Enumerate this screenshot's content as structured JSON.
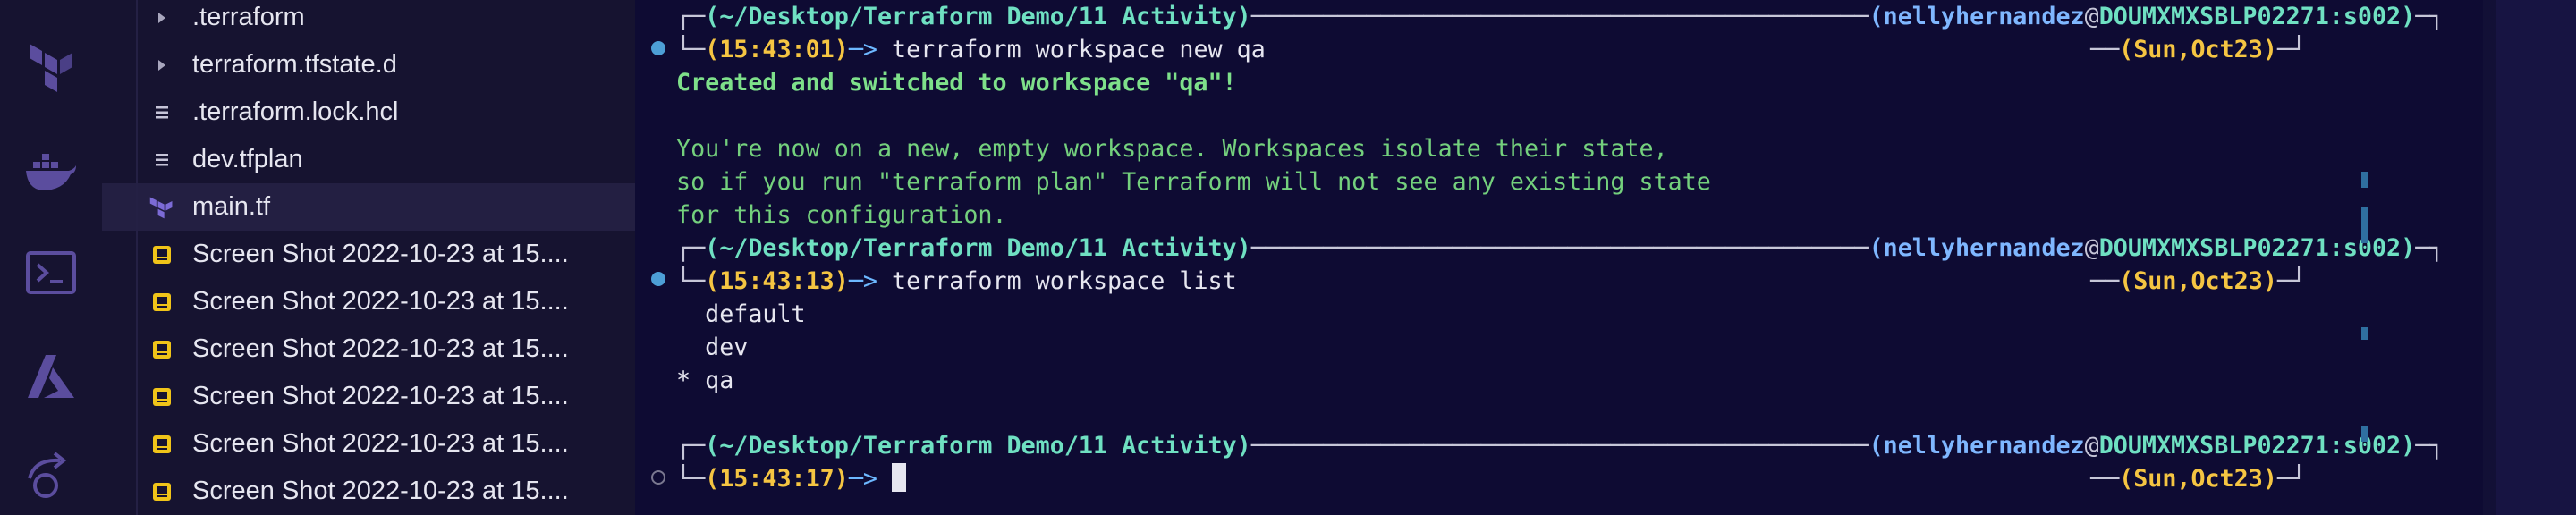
{
  "activity_bar": {
    "icons": [
      "terraform-icon",
      "docker-icon",
      "terminal-icon",
      "azure-icon",
      "remote-explorer-icon"
    ]
  },
  "explorer": {
    "items": [
      {
        "label": ".terraform",
        "icon": "chevron-right-icon"
      },
      {
        "label": "terraform.tfstate.d",
        "icon": "chevron-right-icon"
      },
      {
        "label": ".terraform.lock.hcl",
        "icon": "lines-file-icon"
      },
      {
        "label": "dev.tfplan",
        "icon": "lines-file-icon"
      },
      {
        "label": "main.tf",
        "icon": "terraform-file-icon"
      },
      {
        "label": "Screen Shot 2022-10-23 at 15....",
        "icon": "image-file-icon"
      },
      {
        "label": "Screen Shot 2022-10-23 at 15....",
        "icon": "image-file-icon"
      },
      {
        "label": "Screen Shot 2022-10-23 at 15....",
        "icon": "image-file-icon"
      },
      {
        "label": "Screen Shot 2022-10-23 at 15....",
        "icon": "image-file-icon"
      },
      {
        "label": "Screen Shot 2022-10-23 at 15....",
        "icon": "image-file-icon"
      },
      {
        "label": "Screen Shot 2022-10-23 at 15....",
        "icon": "image-file-icon"
      }
    ]
  },
  "terminal": {
    "prompt": {
      "path": "(~/Desktop/Terraform Demo/11 Activity)",
      "user": "(nellyhernandez",
      "at": "@",
      "host": "DOUMXMXSBLP02271:s002)",
      "date": "(Sun,Oct23)",
      "arrow": "─> "
    },
    "blocks": [
      {
        "time": "(15:43:01)",
        "command": "terraform workspace new qa"
      },
      {
        "time": "(15:43:13)",
        "command": "terraform workspace list"
      },
      {
        "time": "(15:43:17)",
        "command": ""
      }
    ],
    "output1": {
      "headline": "Created and switched to workspace \"qa\"!",
      "lines": [
        "You're now on a new, empty workspace. Workspaces isolate their state,",
        "so if you run \"terraform plan\" Terraform will not see any existing state",
        "for this configuration."
      ]
    },
    "output2": {
      "lines": [
        "  default",
        "  dev",
        "* qa"
      ]
    }
  },
  "colors": {
    "background": "#0e0b33",
    "sidebar": "#161330",
    "path": "#6fe0c2",
    "time": "#f5c542",
    "user": "#7fb7ff",
    "success": "#7ee08a"
  }
}
